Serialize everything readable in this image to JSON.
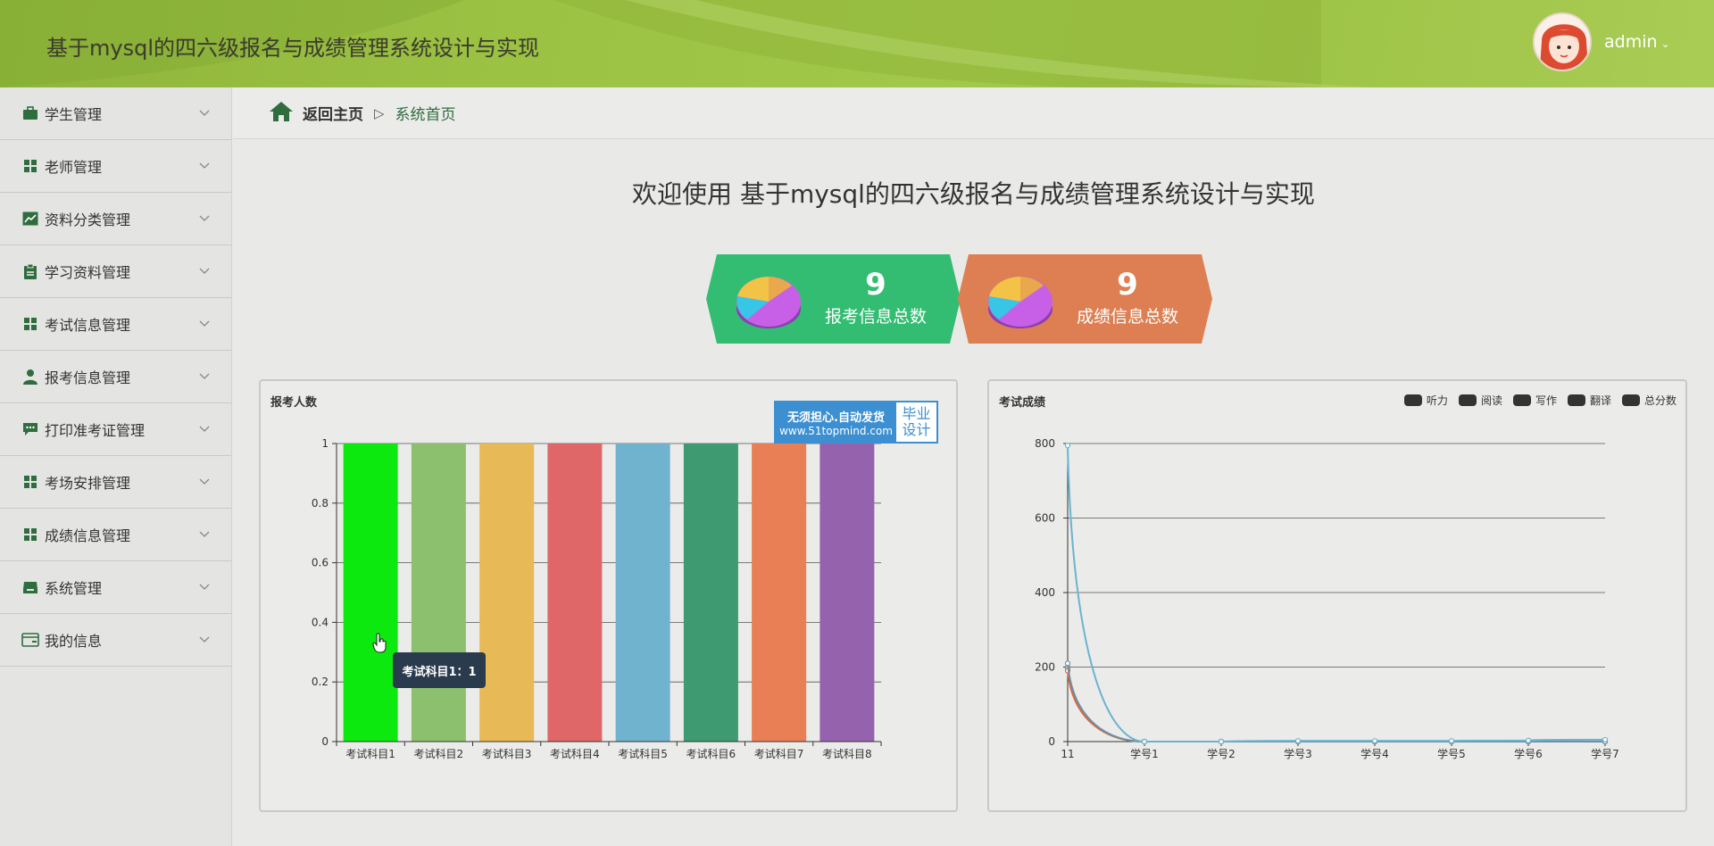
{
  "header": {
    "title": "基于mysql的四六级报名与成绩管理系统设计与实现",
    "user": "admin"
  },
  "sidebar": {
    "items": [
      {
        "label": "学生管理",
        "icon": "briefcase-icon"
      },
      {
        "label": "老师管理",
        "icon": "grid-icon"
      },
      {
        "label": "资料分类管理",
        "icon": "line-chart-icon"
      },
      {
        "label": "学习资料管理",
        "icon": "clipboard-icon"
      },
      {
        "label": "考试信息管理",
        "icon": "grid-icon"
      },
      {
        "label": "报考信息管理",
        "icon": "user-icon"
      },
      {
        "label": "打印准考证管理",
        "icon": "chat-icon"
      },
      {
        "label": "考场安排管理",
        "icon": "grid-icon"
      },
      {
        "label": "成绩信息管理",
        "icon": "grid-icon"
      },
      {
        "label": "系统管理",
        "icon": "inbox-icon"
      },
      {
        "label": "我的信息",
        "icon": "card-icon"
      }
    ]
  },
  "breadcrumb": {
    "back": "返回主页",
    "separator": "▷",
    "current": "系统首页"
  },
  "welcome": "欢迎使用 基于mysql的四六级报名与成绩管理系统设计与实现",
  "stats": [
    {
      "value": "9",
      "label": "报考信息总数",
      "color": "#33bd72"
    },
    {
      "value": "9",
      "label": "成绩信息总数",
      "color": "#dd7f52"
    }
  ],
  "ad": {
    "line1": "无须担心.自动发货",
    "line2": "www.51topmind.com",
    "right1": "毕业",
    "right2": "设计"
  },
  "tooltip": "考试科目1：1",
  "chart_data": [
    {
      "type": "bar",
      "title": "报考人数",
      "categories": [
        "考试科目1",
        "考试科目2",
        "考试科目3",
        "考试科目4",
        "考试科目5",
        "考试科目6",
        "考试科目7",
        "考试科目8"
      ],
      "values": [
        1,
        1,
        1,
        1,
        1,
        1,
        1,
        1
      ],
      "colors": [
        "#0ce90f",
        "#8cc06e",
        "#e8b957",
        "#df6767",
        "#70b3ce",
        "#3e9a70",
        "#e97f54",
        "#9563ad"
      ],
      "yticks": [
        "0",
        "0.2",
        "0.4",
        "0.6",
        "0.8",
        "1"
      ],
      "ylim": [
        0,
        1
      ],
      "grid": true
    },
    {
      "type": "line",
      "title": "考试成绩",
      "x": [
        "11",
        "学号1",
        "学号2",
        "学号3",
        "学号4",
        "学号5",
        "学号6",
        "学号7"
      ],
      "yticks": [
        "0",
        "200",
        "400",
        "600",
        "800"
      ],
      "ylim": [
        0,
        800
      ],
      "grid": true,
      "legend_position": "top-right",
      "series": [
        {
          "name": "听力",
          "values": [
            200,
            0,
            0,
            0,
            0,
            0,
            0,
            0
          ],
          "color": "#5b9bb3"
        },
        {
          "name": "阅读",
          "values": [
            195,
            0,
            0,
            0,
            0,
            0,
            0,
            0
          ],
          "color": "#8a9c5a"
        },
        {
          "name": "写作",
          "values": [
            190,
            0,
            0,
            0,
            0,
            0,
            0,
            0
          ],
          "color": "#d9673e"
        },
        {
          "name": "翻译",
          "values": [
            210,
            0,
            0,
            0,
            0,
            0,
            0,
            0
          ],
          "color": "#6f8fa5"
        },
        {
          "name": "总分数",
          "values": [
            795,
            0,
            0,
            2,
            2,
            2,
            3,
            5
          ],
          "color": "#6cb3cf"
        }
      ]
    }
  ]
}
